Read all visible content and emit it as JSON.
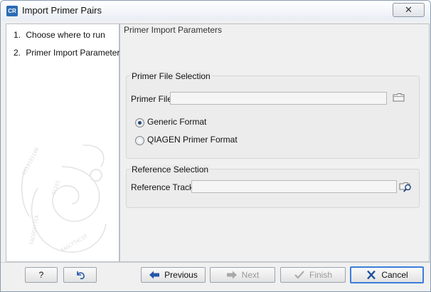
{
  "window": {
    "title": "Import Primer Pairs",
    "app_icon_text": "CR",
    "close_glyph": "✕"
  },
  "steps": [
    {
      "number": "1.",
      "label": "Choose where to run",
      "active": false
    },
    {
      "number": "2.",
      "label": "Primer Import Parameters",
      "active": true
    }
  ],
  "content": {
    "heading": "Primer Import Parameters",
    "primer_file_selection": {
      "group_title": "Primer File Selection",
      "primer_file_label": "Primer File",
      "primer_file_value": "",
      "browse_icon": "folder-icon",
      "formats": [
        {
          "label": "Generic Format",
          "selected": true
        },
        {
          "label": "QIAGEN Primer Format",
          "selected": false
        }
      ]
    },
    "reference_selection": {
      "group_title": "Reference Selection",
      "reference_track_label": "Reference Track",
      "reference_track_value": "",
      "browse_icon": "folder-search-icon"
    }
  },
  "buttons": {
    "help": "?",
    "reset_icon": "reset-arrow-icon",
    "previous": "Previous",
    "next": "Next",
    "finish": "Finish",
    "cancel": "Cancel"
  },
  "colors": {
    "accent": "#3b7dd8",
    "previous_arrow": "#2457a8",
    "cancel_x": "#1d4f9c",
    "app_icon": "#2b6cb3"
  }
}
